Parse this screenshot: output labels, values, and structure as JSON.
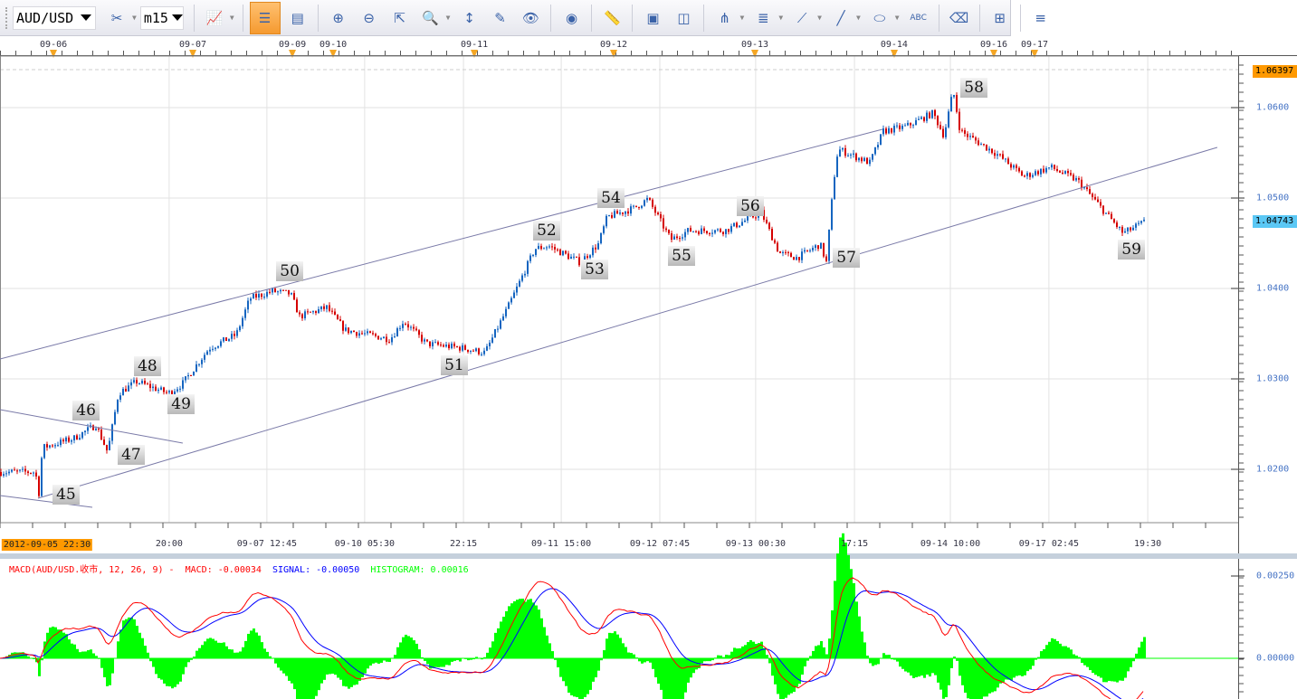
{
  "toolbar": {
    "symbol": "AUD/USD",
    "timeframe": "m15",
    "buttons": [
      {
        "name": "delete-indicator-button",
        "glyph": "✂",
        "dd": true
      },
      {
        "name": "timeframe-select"
      },
      {
        "name": "chart-type-button",
        "glyph": "📈",
        "dd": true
      },
      {
        "name": "tile-vertical-button",
        "glyph": "☰",
        "active": true
      },
      {
        "name": "tile-horizontal-button",
        "glyph": "▤"
      },
      {
        "name": "zoom-in-button",
        "glyph": "⊕"
      },
      {
        "name": "zoom-out-button",
        "glyph": "⊖"
      },
      {
        "name": "cursor-zoom-button",
        "glyph": "⇱"
      },
      {
        "name": "zoom-range-button",
        "glyph": "🔍",
        "dd": true
      },
      {
        "name": "auto-scale-button",
        "glyph": "↕"
      },
      {
        "name": "properties-button",
        "glyph": "✎"
      },
      {
        "name": "hide-button",
        "glyph": "👁"
      },
      {
        "name": "globe-button",
        "glyph": "◉"
      },
      {
        "name": "ruler-button",
        "glyph": "📏"
      },
      {
        "name": "add-image-button",
        "glyph": "▣"
      },
      {
        "name": "compare-window-button",
        "glyph": "◫"
      },
      {
        "name": "pitchfork-tool-button",
        "glyph": "⋔",
        "dd": true
      },
      {
        "name": "fibonacci-tool-button",
        "glyph": "≣",
        "dd": true
      },
      {
        "name": "fan-tool-button",
        "glyph": "⟋",
        "dd": true
      },
      {
        "name": "line-tool-button",
        "glyph": "╱",
        "dd": true
      },
      {
        "name": "ellipse-tool-button",
        "glyph": "⬭",
        "dd": true
      },
      {
        "name": "text-tool-button",
        "glyph": "ABC"
      },
      {
        "name": "eraser-button",
        "glyph": "⌫"
      },
      {
        "name": "object-tree-button",
        "glyph": "⊞"
      },
      {
        "name": "toolbar-overflow-button",
        "glyph": "≡"
      }
    ]
  },
  "top_dates": [
    {
      "t": "09-06",
      "i": 19.7
    },
    {
      "t": "09-07",
      "i": 71
    },
    {
      "t": "09-09",
      "i": 107.7
    },
    {
      "t": "09-10",
      "i": 122.7
    },
    {
      "t": "09-11",
      "i": 174.7
    },
    {
      "t": "09-12",
      "i": 226
    },
    {
      "t": "09-13",
      "i": 278
    },
    {
      "t": "09-14",
      "i": 329.3
    },
    {
      "t": "09-16",
      "i": 366
    },
    {
      "t": "09-17",
      "i": 381
    }
  ],
  "time_labels": [
    {
      "t": "2012-09-05 22:30",
      "i": 0,
      "current": true
    },
    {
      "t": "20:00",
      "i": 62.3
    },
    {
      "t": "09-07 12:45",
      "i": 98.3
    },
    {
      "t": "09-10 05:30",
      "i": 134.3
    },
    {
      "t": "22:15",
      "i": 170.7
    },
    {
      "t": "09-11 15:00",
      "i": 206.7
    },
    {
      "t": "09-12 07:45",
      "i": 243
    },
    {
      "t": "09-13 00:30",
      "i": 278.3
    },
    {
      "t": "17:15",
      "i": 314.7
    },
    {
      "t": "09-14 10:00",
      "i": 350
    },
    {
      "t": "09-17 02:45",
      "i": 386.3
    },
    {
      "t": "19:30",
      "i": 422.7
    }
  ],
  "colors": {
    "up": "#1565c0",
    "down": "#d50000",
    "channel": "#7a7aa8",
    "grid": "#e2e2e2",
    "macd": "#ff0000",
    "signal": "#0000ff",
    "histogram": "#00ff00",
    "current_time": "#ff9900",
    "high_tag": "#ff9900",
    "last_tag": "#5bc8f5"
  },
  "chart_data": {
    "type": "candlestick",
    "symbol": "AUD/USD",
    "timeframe": "m15",
    "ylim": [
      1.013,
      1.065
    ],
    "y_ticks": [
      "1.0200",
      "1.0300",
      "1.0400",
      "1.0500",
      "1.0600"
    ],
    "high_tag": "1.06397",
    "last_tag": "1.04743",
    "path": [
      [
        0,
        1.0197
      ],
      [
        12.7,
        1.0197
      ],
      [
        14,
        1.0174
      ],
      [
        15.3,
        1.0224
      ],
      [
        26.7,
        1.0234
      ],
      [
        35,
        1.0249
      ],
      [
        39.3,
        1.0219
      ],
      [
        43.3,
        1.0284
      ],
      [
        50,
        1.0297
      ],
      [
        61.7,
        1.0284
      ],
      [
        66.7,
        1.0294
      ],
      [
        76.7,
        1.0334
      ],
      [
        86.7,
        1.0349
      ],
      [
        91.7,
        1.0389
      ],
      [
        100,
        1.0397
      ],
      [
        106.7,
        1.0394
      ],
      [
        110,
        1.0369
      ],
      [
        120,
        1.0379
      ],
      [
        126.7,
        1.0354
      ],
      [
        143.3,
        1.0344
      ],
      [
        148.3,
        1.0364
      ],
      [
        156.7,
        1.0339
      ],
      [
        170,
        1.0334
      ],
      [
        178.3,
        1.0329
      ],
      [
        186.7,
        1.0379
      ],
      [
        196.7,
        1.0444
      ],
      [
        201.7,
        1.0447
      ],
      [
        213.3,
        1.0429
      ],
      [
        220,
        1.0449
      ],
      [
        223.3,
        1.0479
      ],
      [
        233.3,
        1.0489
      ],
      [
        238.3,
        1.0499
      ],
      [
        246.7,
        1.0454
      ],
      [
        253.3,
        1.0464
      ],
      [
        266.7,
        1.0464
      ],
      [
        280,
        1.0484
      ],
      [
        286.7,
        1.0439
      ],
      [
        293.3,
        1.0434
      ],
      [
        301.7,
        1.0449
      ],
      [
        304,
        1.0429
      ],
      [
        306.7,
        1.0519
      ],
      [
        308.3,
        1.0554
      ],
      [
        320,
        1.0539
      ],
      [
        325,
        1.0574
      ],
      [
        333.3,
        1.0579
      ],
      [
        343.3,
        1.0594
      ],
      [
        347.3,
        1.0569
      ],
      [
        350.7,
        1.0619
      ],
      [
        353.3,
        1.0574
      ],
      [
        366.7,
        1.0549
      ],
      [
        376.7,
        1.0524
      ],
      [
        386.7,
        1.0534
      ],
      [
        396.7,
        1.0519
      ],
      [
        406.7,
        1.0484
      ],
      [
        413.3,
        1.0461
      ],
      [
        421.7,
        1.04743
      ]
    ],
    "channel_lines": [
      [
        [
          0,
          1.0322
        ],
        [
          325,
          1.0576
        ]
      ],
      [
        [
          14,
          1.0168
        ],
        [
          448.3,
          1.0556
        ]
      ],
      [
        [
          0,
          1.0266
        ],
        [
          67.3,
          1.0229
        ]
      ],
      [
        [
          0,
          1.0171
        ],
        [
          34,
          1.0158
        ]
      ]
    ],
    "wave_labels": [
      {
        "t": "45",
        "i": 24.3,
        "p": 1.0172
      },
      {
        "t": "46",
        "i": 31.7,
        "p": 1.0265
      },
      {
        "t": "47",
        "i": 48.3,
        "p": 1.0216
      },
      {
        "t": "48",
        "i": 54.3,
        "p": 1.0314
      },
      {
        "t": "49",
        "i": 66.7,
        "p": 1.0272
      },
      {
        "t": "50",
        "i": 106.7,
        "p": 1.0419
      },
      {
        "t": "51",
        "i": 167.3,
        "p": 1.0315
      },
      {
        "t": "52",
        "i": 201.3,
        "p": 1.0464
      },
      {
        "t": "53",
        "i": 219,
        "p": 1.0421
      },
      {
        "t": "54",
        "i": 225,
        "p": 1.05
      },
      {
        "t": "55",
        "i": 251,
        "p": 1.0436
      },
      {
        "t": "56",
        "i": 276.3,
        "p": 1.0491
      },
      {
        "t": "57",
        "i": 311.7,
        "p": 1.0434
      },
      {
        "t": "58",
        "i": 358.7,
        "p": 1.0622
      },
      {
        "t": "59",
        "i": 416.7,
        "p": 1.0443
      }
    ],
    "macd": {
      "label": "MACD(AUD/USD.收市, 12, 26, 9)",
      "sep": " - ",
      "macd_text": "MACD: -0.00034",
      "signal_text": "SIGNAL: -0.00050",
      "hist_text": "HISTOGRAM: 0.00016",
      "params": [
        12,
        26,
        9
      ],
      "ylim": [
        -0.00155,
        0.00305
      ],
      "y_ticks": [
        "0.00000",
        "0.00250"
      ]
    }
  }
}
